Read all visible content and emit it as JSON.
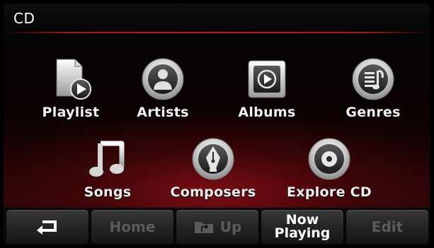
{
  "header": {
    "title": "CD"
  },
  "menu": {
    "row1": [
      {
        "label": "Playlist",
        "icon": "playlist-icon"
      },
      {
        "label": "Artists",
        "icon": "artist-icon"
      },
      {
        "label": "Albums",
        "icon": "album-icon"
      },
      {
        "label": "Genres",
        "icon": "genre-icon"
      }
    ],
    "row2": [
      {
        "label": "Songs",
        "icon": "music-note-icon"
      },
      {
        "label": "Composers",
        "icon": "pen-nib-icon"
      },
      {
        "label": "Explore CD",
        "icon": "disc-icon"
      }
    ]
  },
  "bottom_bar": {
    "back_icon": "back-arrow-icon",
    "home_label": "Home",
    "up_label": "Up",
    "up_icon": "folder-up-icon",
    "now_playing_line1": "Now",
    "now_playing_line2": "Playing",
    "edit_label": "Edit",
    "enabled_color": "#ffffff",
    "disabled_color": "#5b5b5b"
  },
  "colors": {
    "accent_red": "#c8141f",
    "background": "#000000"
  }
}
